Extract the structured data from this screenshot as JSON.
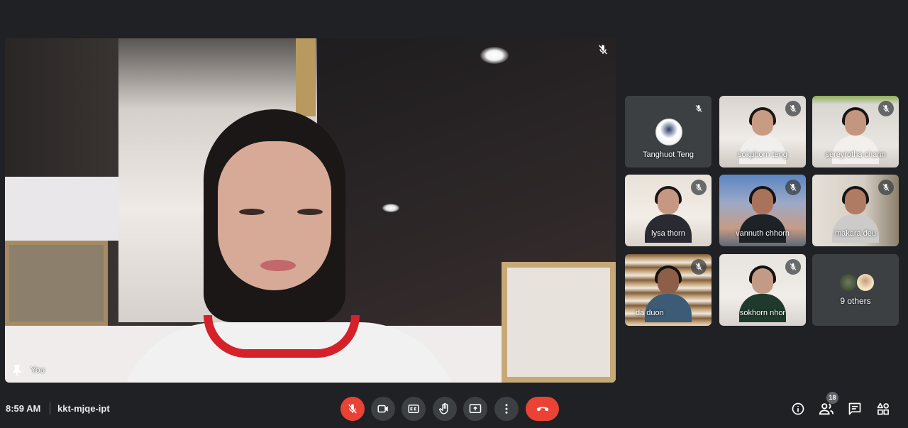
{
  "main_video": {
    "participant_label": "You",
    "mic_muted": true
  },
  "participants": [
    {
      "name": "Tanghuot Teng",
      "mic_muted": true,
      "kind": "avatar"
    },
    {
      "name": "sokphorn teng",
      "mic_muted": true,
      "kind": "video"
    },
    {
      "name": "sereyrotha chann",
      "mic_muted": true,
      "kind": "video"
    },
    {
      "name": "lysa thorn",
      "mic_muted": true,
      "kind": "video"
    },
    {
      "name": "vannuth chhorn",
      "mic_muted": true,
      "kind": "video"
    },
    {
      "name": "makara deu",
      "mic_muted": true,
      "kind": "video"
    },
    {
      "name": "da duon",
      "mic_muted": true,
      "kind": "video"
    },
    {
      "name": "sokhorn nhor",
      "mic_muted": true,
      "kind": "video"
    }
  ],
  "others_tile": {
    "label": "9 others"
  },
  "bottom_bar": {
    "time": "8:59 AM",
    "meeting_code": "kkt-mjqe-ipt",
    "controls": [
      {
        "icon": "mic-off-icon",
        "active": false,
        "color": "#ea4335"
      },
      {
        "icon": "camera-icon"
      },
      {
        "icon": "captions-icon"
      },
      {
        "icon": "raise-hand-icon"
      },
      {
        "icon": "present-screen-icon"
      },
      {
        "icon": "more-options-icon"
      },
      {
        "icon": "hang-up-icon",
        "color": "#ea4335"
      }
    ],
    "right_icons": [
      "info-icon",
      "people-icon",
      "chat-icon",
      "activities-icon"
    ],
    "people_count": "18"
  },
  "colors": {
    "background": "#202124",
    "tile": "#3c4043",
    "danger": "#ea4335"
  }
}
